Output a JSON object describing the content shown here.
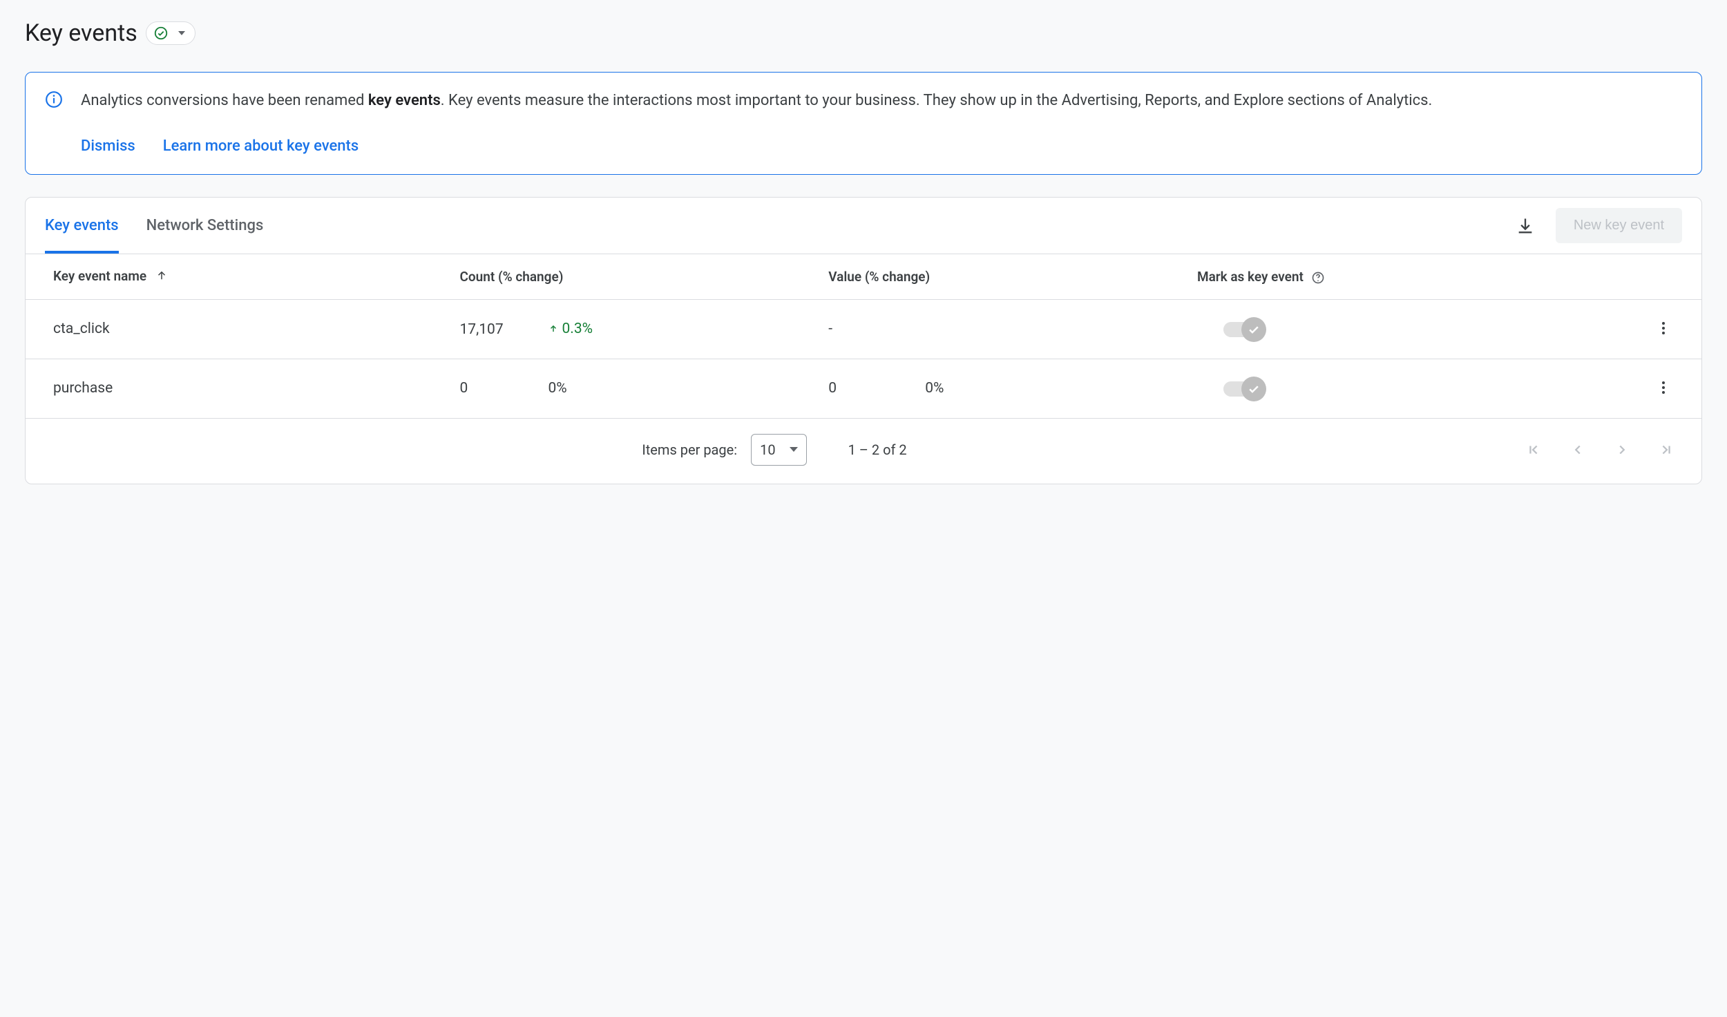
{
  "header": {
    "title": "Key events"
  },
  "banner": {
    "text_pre": "Analytics conversions have been renamed ",
    "text_bold": "key events",
    "text_post": ". Key events measure the interactions most important to your business. They show up in the Advertising, Reports, and Explore sections of Analytics.",
    "dismiss": "Dismiss",
    "learn_more": "Learn more about key events"
  },
  "tabs": [
    {
      "label": "Key events",
      "active": true
    },
    {
      "label": "Network Settings",
      "active": false
    }
  ],
  "actions": {
    "new_event": "New key event"
  },
  "table": {
    "columns": {
      "name": "Key event name",
      "count": "Count (% change)",
      "value": "Value (% change)",
      "mark": "Mark as key event"
    },
    "rows": [
      {
        "name": "cta_click",
        "count": "17,107",
        "count_change": "0.3%",
        "count_dir": "up",
        "value": "-",
        "value_change": "",
        "toggle_on": true
      },
      {
        "name": "purchase",
        "count": "0",
        "count_change": "0%",
        "count_dir": "none",
        "value": "0",
        "value_change": "0%",
        "toggle_on": true
      }
    ]
  },
  "paginator": {
    "items_per_page_label": "Items per page:",
    "page_size": "10",
    "range": "1 – 2 of 2"
  }
}
